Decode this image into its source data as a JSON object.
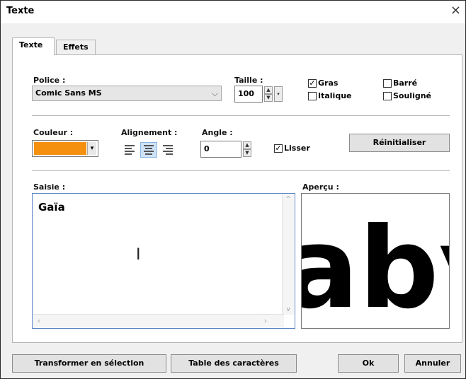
{
  "window": {
    "title": "Texte",
    "close_glyph": "×"
  },
  "tabs": [
    {
      "label": "Texte",
      "active": true
    },
    {
      "label": "Effets",
      "active": false
    }
  ],
  "font": {
    "label": "Police :",
    "value": "Comic Sans MS",
    "size_label": "Taille :",
    "size_value": "100"
  },
  "style_checks": {
    "bold": {
      "label": "Gras",
      "checked": true
    },
    "italic": {
      "label": "Italique",
      "checked": false
    },
    "strike": {
      "label": "Barré",
      "checked": false
    },
    "underline": {
      "label": "Souligné",
      "checked": false
    }
  },
  "color": {
    "label": "Couleur :",
    "value": "#f5900f"
  },
  "alignment": {
    "label": "Alignement :",
    "options": [
      "left",
      "center",
      "right"
    ],
    "selected": "center"
  },
  "angle": {
    "label": "Angle :",
    "value": "0"
  },
  "smooth": {
    "label": "Lisser",
    "checked": true
  },
  "reset_button": "Réinitialiser",
  "input": {
    "label": "Saisie :",
    "value": "Gaïa"
  },
  "preview": {
    "label": "Aperçu :",
    "glyphs": "aby"
  },
  "buttons": {
    "transform": "Transformer en sélection",
    "charmap": "Table des caractères",
    "ok": "Ok",
    "cancel": "Annuler"
  },
  "icons": {
    "close": "close-icon",
    "dropdown": "chevron-down-icon",
    "spin_up": "spin-up-icon",
    "spin_down": "spin-down-icon",
    "text_cursor": "text-cursor-icon"
  }
}
